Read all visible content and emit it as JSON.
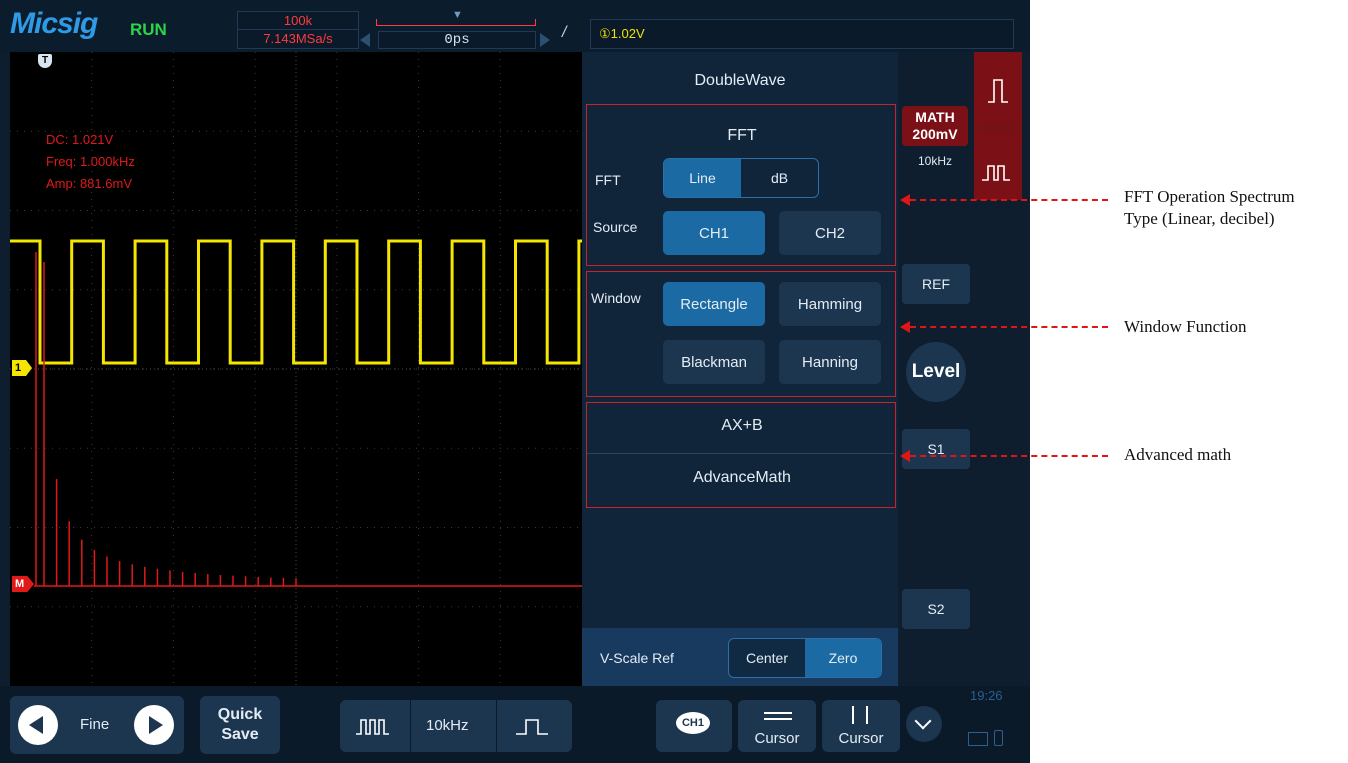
{
  "header": {
    "brand": "Micsig",
    "run_state": "RUN",
    "record_length": "100k",
    "sample_rate": "7.143MSa/s",
    "horizontal_position": "0ps",
    "trigger_slope": "/",
    "trigger_level": "\u00001.02V"
  },
  "waveform": {
    "measurements": [
      "DC: 1.021V",
      "Freq: 1.000kHz",
      "Amp: 881.6mV"
    ],
    "trigger_marker": "T",
    "ch1_marker": "1",
    "math_marker": "M",
    "ch1_color": "#f4e600",
    "math_color": "#e01919",
    "fft_magnitudes": [
      1.0,
      0.33,
      0.2,
      0.143,
      0.111,
      0.091,
      0.077,
      0.067,
      0.059,
      0.053,
      0.048,
      0.043,
      0.04,
      0.037,
      0.034,
      0.032,
      0.03,
      0.028,
      0.026,
      0.025,
      0.024
    ]
  },
  "menu": {
    "title": "DoubleWave",
    "fft": {
      "title": "FFT",
      "type_label": "FFT",
      "type_options": [
        "Line",
        "dB"
      ],
      "type_selected": "Line",
      "source_label": "Source",
      "source_options": [
        "CH1",
        "CH2"
      ],
      "source_selected": "CH1"
    },
    "window": {
      "label": "Window",
      "options": [
        "Rectangle",
        "Hamming",
        "Blackman",
        "Hanning"
      ],
      "selected": "Rectangle"
    },
    "axb_label": "AX+B",
    "advanced_label": "AdvanceMath",
    "vscale": {
      "label": "V-Scale Ref",
      "options": [
        "Center",
        "Zero"
      ],
      "selected": "Zero"
    }
  },
  "sidebar": {
    "math_title": "MATH",
    "math_scale": "200mV",
    "math_freq": "10kHz",
    "ref_label": "REF",
    "level_label": "Level",
    "s1_label": "S1",
    "s2_label": "S2",
    "time": "19:26"
  },
  "bottom": {
    "fine_label": "Fine",
    "quick_save_line1": "Quick",
    "quick_save_line2": "Save",
    "auto_freq": "10kHz",
    "ch1_chip": "CH1",
    "cursor_h_label": "Cursor",
    "cursor_v_label": "Cursor"
  },
  "annotations": {
    "fft_type_line1": "FFT Operation Spectrum",
    "fft_type_line2": "Type (Linear, decibel)",
    "window_function": "Window Function",
    "advanced_math": "Advanced math"
  }
}
